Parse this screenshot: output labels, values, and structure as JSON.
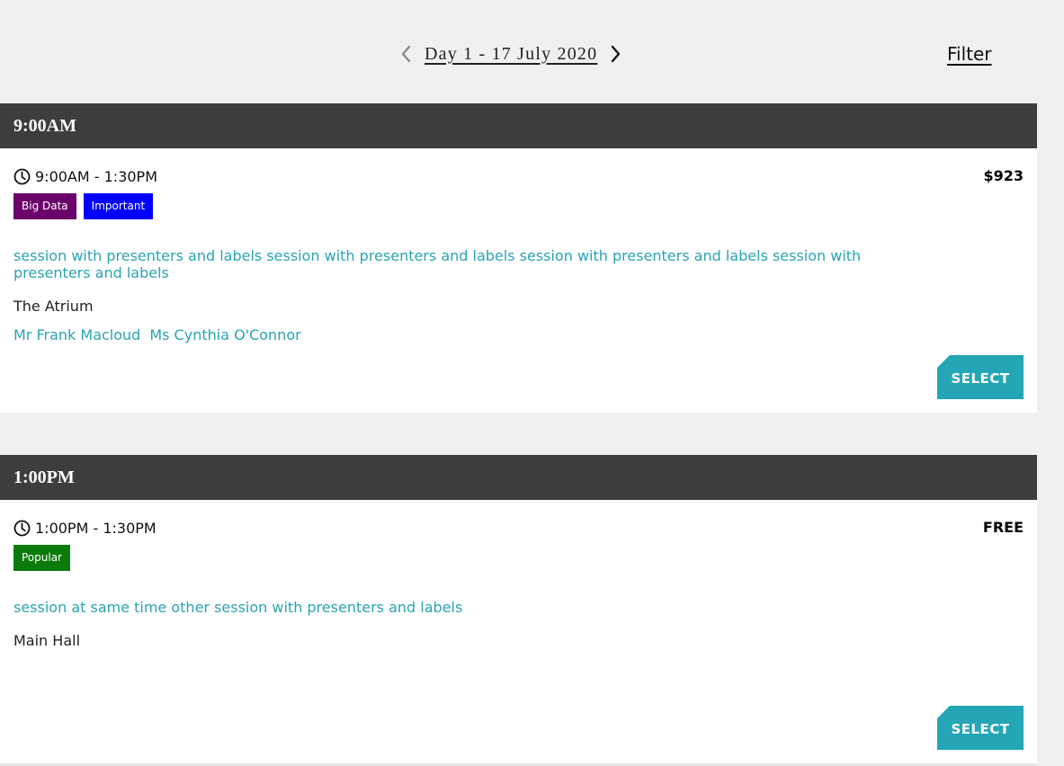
{
  "day_nav": {
    "title": "Day 1 - 17 July 2020",
    "prev_icon": "chevron-left-icon",
    "next_icon": "chevron-right-icon",
    "filter_label": "Filter"
  },
  "colors": {
    "header_bg": "#3d3d3d",
    "link": "#2aa3b3",
    "select_button": "#24a6b6",
    "page_bg": "#f0f0f0"
  },
  "slots": [
    {
      "heading": "9:00AM",
      "session": {
        "time_icon": "clock-icon",
        "time": "9:00AM - 1:30PM",
        "price": "$923",
        "labels": [
          {
            "text": "Big Data",
            "color": "#6b006b"
          },
          {
            "text": "Important",
            "color": "#0000ff"
          }
        ],
        "title": "session with presenters and labels session with presenters and labels session with presenters and labels session with presenters and labels",
        "location": "The Atrium",
        "presenters": [
          "Mr Frank Macloud",
          "Ms Cynthia O'Connor"
        ],
        "button_label": "SELECT"
      }
    },
    {
      "heading": "1:00PM",
      "session": {
        "time_icon": "clock-icon",
        "time": "1:00PM - 1:30PM",
        "price": "FREE",
        "labels": [
          {
            "text": "Popular",
            "color": "#0a7a0a"
          }
        ],
        "title": "session at same time other session with presenters and labels",
        "location": "Main Hall",
        "presenters": [],
        "button_label": "SELECT"
      }
    }
  ]
}
